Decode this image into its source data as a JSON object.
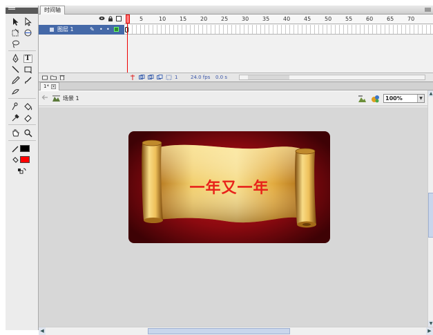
{
  "timeline": {
    "tab_label": "时间轴",
    "ruler_numbers": [
      "5",
      "10",
      "15",
      "20",
      "25",
      "30",
      "35",
      "40",
      "45",
      "50",
      "55",
      "60",
      "65",
      "70"
    ],
    "header_icons": [
      "eye-icon",
      "lock-icon",
      "outline-icon"
    ],
    "layer": {
      "name": "图层 1",
      "edit_glyph": "✎",
      "dot_glyph": "•"
    },
    "footer": {
      "frame_number": "1",
      "frame_rate": "24.0 fps",
      "elapsed": "0.0 s"
    }
  },
  "document": {
    "tab_label": "1*",
    "close_glyph": "×",
    "scene_label": "场景 1",
    "zoom": "100%"
  },
  "stage": {
    "banner_text": "一年又一年",
    "colors": {
      "background_center": "#c9161c",
      "background_edge": "#3e0205",
      "scroll_gold": "#e0ac3b",
      "text": "#e8211a"
    }
  },
  "tools": {
    "stroke_color": "#000000",
    "fill_color": "#ff0000",
    "text_tool_label": "T"
  }
}
